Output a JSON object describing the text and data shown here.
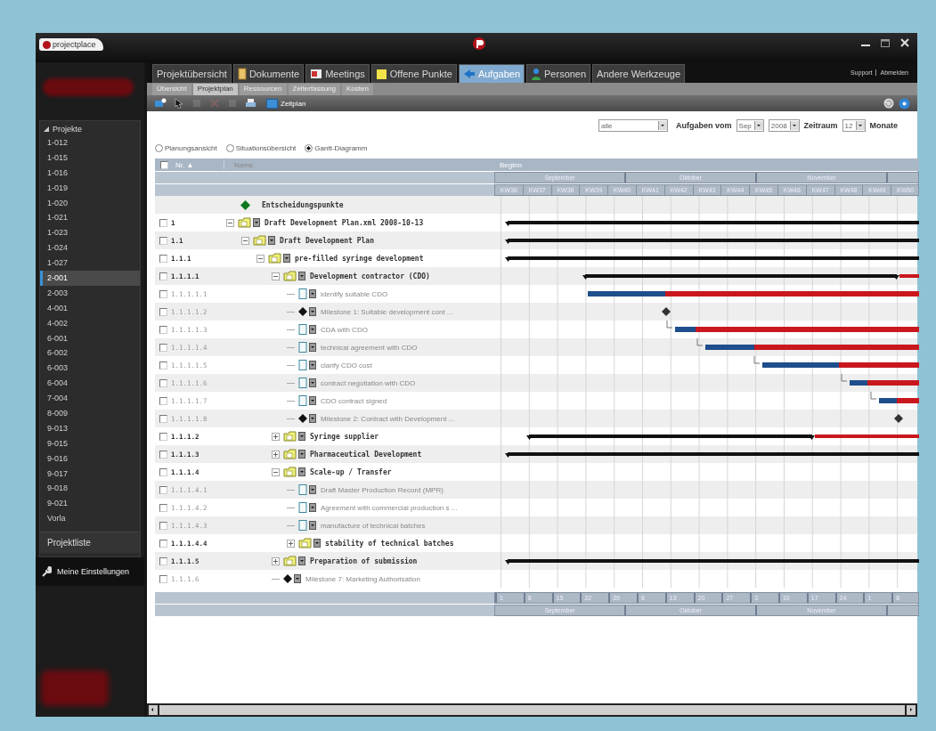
{
  "window": {
    "logo": "projectplace"
  },
  "tabs": [
    {
      "label": "Projektübersicht",
      "selected": false
    },
    {
      "label": "Dokumente",
      "selected": false
    },
    {
      "label": "Meetings",
      "selected": false
    },
    {
      "label": "Offene Punkte",
      "selected": false
    },
    {
      "label": "Aufgaben",
      "selected": true
    },
    {
      "label": "Personen",
      "selected": false
    },
    {
      "label": "Andere Werkzeuge",
      "selected": false
    }
  ],
  "header_links": [
    "Support",
    "Abmelden"
  ],
  "subtabs": [
    {
      "label": "Übersicht",
      "selected": false
    },
    {
      "label": "Projektplan",
      "selected": true
    },
    {
      "label": "Ressourcen",
      "selected": false
    },
    {
      "label": "Zeiterfassung",
      "selected": false
    },
    {
      "label": "Kosten",
      "selected": false
    }
  ],
  "toolbar": {
    "schedule_button": "Zeitplan"
  },
  "sidebar": {
    "section": "Projekte",
    "expanded": true,
    "items": [
      {
        "label": "1-012",
        "selected": false
      },
      {
        "label": "1-015",
        "selected": false
      },
      {
        "label": "1-016",
        "selected": false
      },
      {
        "label": "1-019",
        "selected": false
      },
      {
        "label": "1-020",
        "selected": false
      },
      {
        "label": "1-021",
        "selected": false
      },
      {
        "label": "1-023",
        "selected": false
      },
      {
        "label": "1-024",
        "selected": false
      },
      {
        "label": "1-027",
        "selected": false
      },
      {
        "label": "2-001",
        "selected": true
      },
      {
        "label": "2-003",
        "selected": false
      },
      {
        "label": "4-001",
        "selected": false
      },
      {
        "label": "4-002",
        "selected": false
      },
      {
        "label": "6-001",
        "selected": false
      },
      {
        "label": "6-002",
        "selected": false
      },
      {
        "label": "6-003",
        "selected": false
      },
      {
        "label": "6-004",
        "selected": false
      },
      {
        "label": "7-004",
        "selected": false
      },
      {
        "label": "8-009",
        "selected": false
      },
      {
        "label": "9-013",
        "selected": false
      },
      {
        "label": "9-015",
        "selected": false
      },
      {
        "label": "9-016",
        "selected": false
      },
      {
        "label": "9-017",
        "selected": false
      },
      {
        "label": "9-018",
        "selected": false
      },
      {
        "label": "9-021",
        "selected": false
      },
      {
        "label": "Vorla",
        "selected": false
      }
    ],
    "project_list": "Projektliste",
    "settings": "Meine Einstellungen"
  },
  "filter": {
    "assignee": "alle",
    "from_label": "Aufgaben vom",
    "month": "Sep",
    "year": "2008",
    "period_label": "Zeitraum",
    "period": "12",
    "unit": "Monate"
  },
  "views": [
    {
      "label": "Planungsansicht",
      "selected": false
    },
    {
      "label": "Situationsübersicht",
      "selected": false
    },
    {
      "label": "Gantt-Diagramm",
      "selected": true
    }
  ],
  "table": {
    "select_all_checked": false,
    "columns": [
      "Nr. ▲",
      "Name"
    ],
    "rows": [
      {
        "name": "Entscheidungspunkte",
        "kind": "decision"
      },
      {
        "number": "1",
        "name": "Draft Development Plan.xml 2008-10-13",
        "kind": "group",
        "checked": false,
        "expanded": true,
        "children": [
          {
            "number": "1.1",
            "name": "Draft Development Plan",
            "kind": "group",
            "checked": false,
            "expanded": true,
            "children": [
              {
                "number": "1.1.1",
                "name": "pre-filled syringe development",
                "kind": "group",
                "checked": false,
                "expanded": true,
                "children": [
                  {
                    "number": "1.1.1.1",
                    "name": "Development contractor (CDO)",
                    "kind": "group",
                    "checked": false,
                    "expanded": true,
                    "children": [
                      {
                        "number": "1.1.1.1.1",
                        "name": "identify suitable CDO",
                        "kind": "task",
                        "checked": false
                      },
                      {
                        "number": "1.1.1.1.2",
                        "name": "Milestone 1: Suitable development cont ...",
                        "kind": "milestone",
                        "checked": false
                      },
                      {
                        "number": "1.1.1.1.3",
                        "name": "CDA with CDO",
                        "kind": "task",
                        "checked": false
                      },
                      {
                        "number": "1.1.1.1.4",
                        "name": "technical agreement with CDO",
                        "kind": "task",
                        "checked": false
                      },
                      {
                        "number": "1.1.1.1.5",
                        "name": "clarify CDO cost",
                        "kind": "task",
                        "checked": false
                      },
                      {
                        "number": "1.1.1.1.6",
                        "name": "contract negotiation with CDO",
                        "kind": "task",
                        "checked": false
                      },
                      {
                        "number": "1.1.1.1.7",
                        "name": "CDO contract signed",
                        "kind": "task",
                        "checked": false
                      },
                      {
                        "number": "1.1.1.1.8",
                        "name": "Milestone 2: Contract with Development ...",
                        "kind": "milestone",
                        "checked": false
                      }
                    ]
                  },
                  {
                    "number": "1.1.1.2",
                    "name": "Syringe supplier",
                    "kind": "group",
                    "checked": false,
                    "expanded": false
                  },
                  {
                    "number": "1.1.1.3",
                    "name": "Pharmaceutical Development",
                    "kind": "group",
                    "checked": false,
                    "expanded": false
                  },
                  {
                    "number": "1.1.1.4",
                    "name": "Scale-up / Transfer",
                    "kind": "group",
                    "checked": false,
                    "expanded": true,
                    "children": [
                      {
                        "number": "1.1.1.4.1",
                        "name": "Draft Master Production Record (MPR)",
                        "kind": "task",
                        "checked": false
                      },
                      {
                        "number": "1.1.1.4.2",
                        "name": "Agreement with commercial production s ...",
                        "kind": "task",
                        "checked": false
                      },
                      {
                        "number": "1.1.1.4.3",
                        "name": "manufacture of technical batches",
                        "kind": "task",
                        "checked": false
                      },
                      {
                        "number": "1.1.1.4.4",
                        "name": "stability of technical batches",
                        "kind": "group",
                        "checked": false,
                        "expanded": false
                      }
                    ]
                  },
                  {
                    "number": "1.1.1.5",
                    "name": "Preparation of submission",
                    "kind": "group",
                    "checked": false,
                    "expanded": false
                  },
                  {
                    "number": "1.1.1.6",
                    "name": "Milestone 7: Marketing Authorisation",
                    "kind": "milestone",
                    "checked": false
                  }
                ]
              }
            ]
          }
        ]
      }
    ]
  },
  "gantt": {
    "header": "Beginn",
    "months": [
      "September",
      "Oktober",
      "November"
    ],
    "weeks": [
      "KW36",
      "KW37",
      "KW38",
      "KW39",
      "KW40",
      "KW41",
      "KW42",
      "KW43",
      "KW44",
      "KW45",
      "KW46",
      "KW47",
      "KW48",
      "KW49",
      "KW50"
    ],
    "days": [
      "1",
      "8",
      "15",
      "22",
      "29",
      "6",
      "13",
      "20",
      "27",
      "3",
      "10",
      "17",
      "24",
      "1",
      "8"
    ],
    "footer_months": [
      "September",
      "Oktober",
      "November"
    ]
  }
}
